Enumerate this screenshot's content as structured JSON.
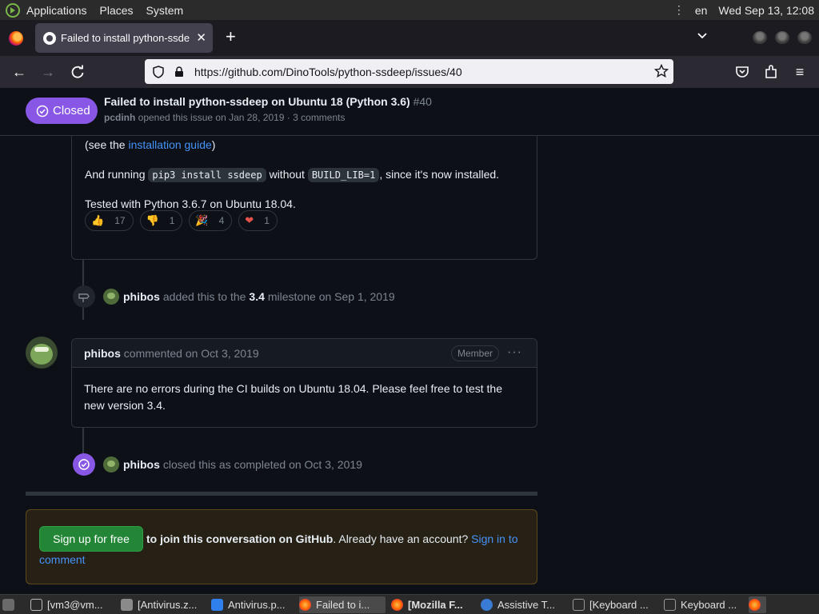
{
  "os_bar": {
    "menus": [
      "Applications",
      "Places",
      "System"
    ],
    "lang": "en",
    "clock": "Wed Sep 13, 12:08"
  },
  "browser": {
    "tab_title": "Failed to install python-ssdeep on Ubuntu 18 (Python 3.6)",
    "tab_title_visible": "Failed to install python-ssde",
    "url": "https://github.com/DinoTools/python-ssdeep/issues/40"
  },
  "issue": {
    "state": "Closed",
    "title": "Failed to install python-ssdeep on Ubuntu 18 (Python 3.6)",
    "number": "#40",
    "author": "pcdinh",
    "meta_text": " opened this issue on Jan 28, 2019 · 3 comments"
  },
  "comment1": {
    "line1_pre": "(see the ",
    "line1_link": "installation guide",
    "line1_post": ")",
    "line2_pre": "And running ",
    "line2_code1": "pip3 install ssdeep",
    "line2_mid": " without ",
    "line2_code2": "BUILD_LIB=1",
    "line2_post": ", since it's now installed.",
    "line3": "Tested with Python 3.6.7 on Ubuntu 18.04.",
    "reactions": [
      {
        "emoji": "👍",
        "count": "17"
      },
      {
        "emoji": "👎",
        "count": "1"
      },
      {
        "emoji": "🎉",
        "count": "4"
      },
      {
        "emoji": "❤",
        "count": "1"
      }
    ]
  },
  "event_milestone": {
    "actor": "phibos",
    "pre": "added this to the",
    "milestone": "3.4",
    "post": "milestone on Sep 1, 2019"
  },
  "comment2": {
    "author": "phibos",
    "action": " commented on Oct 3, 2019",
    "role": "Member",
    "more": "···",
    "body": "There are no errors during the CI builds on Ubuntu 18.04. Please feel free to test the new version 3.4."
  },
  "event_closed": {
    "actor": "phibos",
    "text": "closed this as completed on Oct 3, 2019"
  },
  "signup": {
    "button": "Sign up for free",
    "bold_text": "to join this conversation on GitHub",
    "plain_text": ". Already have an account? ",
    "link1": "Sign in to",
    "link2": "comment"
  },
  "taskbar": {
    "items": [
      "[vm3@vm...",
      "[Antivirus.z...",
      "Antivirus.p...",
      "Failed to i...",
      "[Mozilla F...",
      "Assistive T...",
      "[Keyboard ...",
      "Keyboard ..."
    ]
  },
  "colors": {
    "closed_purple": "#8957e5",
    "link_blue": "#4493f8",
    "signup_green": "#238636",
    "bg": "#0d1117"
  }
}
